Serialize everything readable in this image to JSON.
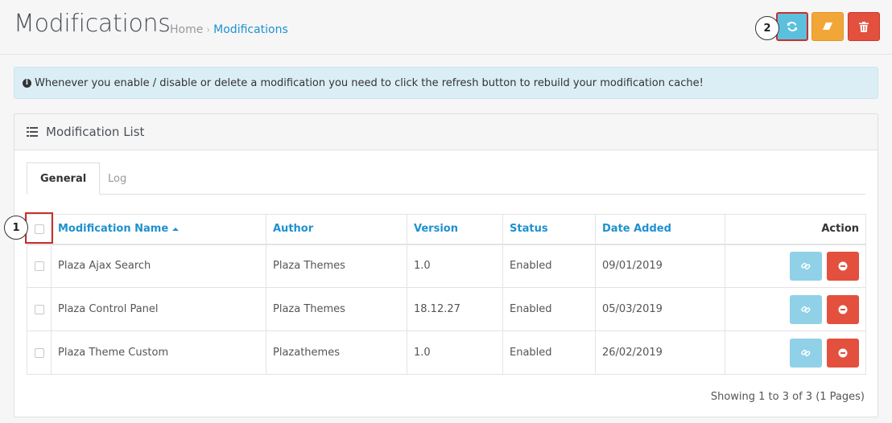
{
  "header": {
    "title": "Modifications",
    "breadcrumb": [
      {
        "label": "Home"
      },
      {
        "label": "Modifications"
      }
    ],
    "buttons": {
      "refresh": "refresh-icon",
      "clear": "eraser-icon",
      "delete": "trash-icon"
    }
  },
  "markers": {
    "one": "1",
    "two": "2"
  },
  "alert": {
    "text": "Whenever you enable / disable or delete a modification you need to click the refresh button to rebuild your modification cache!"
  },
  "panel": {
    "title": "Modification List",
    "tabs": [
      {
        "label": "General"
      },
      {
        "label": "Log"
      }
    ]
  },
  "table": {
    "columns": [
      "Modification Name",
      "Author",
      "Version",
      "Status",
      "Date Added",
      "Action"
    ],
    "rows": [
      {
        "name": "Plaza Ajax Search",
        "author": "Plaza Themes",
        "version": "1.0",
        "status": "Enabled",
        "date": "09/01/2019"
      },
      {
        "name": "Plaza Control Panel",
        "author": "Plaza Themes",
        "version": "18.12.27",
        "status": "Enabled",
        "date": "05/03/2019"
      },
      {
        "name": "Plaza Theme Custom",
        "author": "Plazathemes",
        "version": "1.0",
        "status": "Enabled",
        "date": "26/02/2019"
      }
    ]
  },
  "pagination": {
    "text": "Showing 1 to 3 of 3 (1 Pages)"
  },
  "colors": {
    "accent": "#1e91cf",
    "info": "#5bc0de",
    "warning": "#f3a638",
    "danger": "#e3503e",
    "highlight": "#c9302c"
  }
}
